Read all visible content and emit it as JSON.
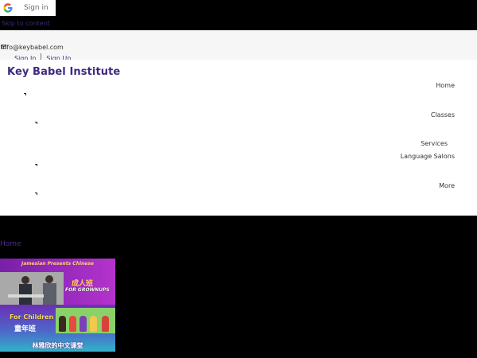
{
  "google_signin": {
    "label": "Sign in",
    "icon": "google-g-icon"
  },
  "skip_link": "Skip to content",
  "info_bar": {
    "email": "info@keybabel.com",
    "icon": "mail-icon"
  },
  "auth": {
    "signin": "Sign In",
    "signup": "Sign Up"
  },
  "brand": "Key Babel Institute",
  "nav": {
    "items": [
      {
        "label": "Home",
        "has_caret": true
      },
      {
        "label": "Classes",
        "has_caret": true
      },
      {
        "label": "Services",
        "has_caret": false
      },
      {
        "label": "Language Salons",
        "has_caret": true
      },
      {
        "label": "More",
        "has_caret": true
      }
    ]
  },
  "breadcrumb": "Home",
  "banner": {
    "title": "Jamesian Presents Chinese",
    "adults_zh": "成人班",
    "adults_en": "FOR GROWNUPS",
    "children_en": "For Children",
    "children_zh": "童年班",
    "footer": "林雅欣的中文课堂"
  },
  "colors": {
    "brand": "#3e2980",
    "background": "#000000",
    "header": "#ffffff"
  }
}
